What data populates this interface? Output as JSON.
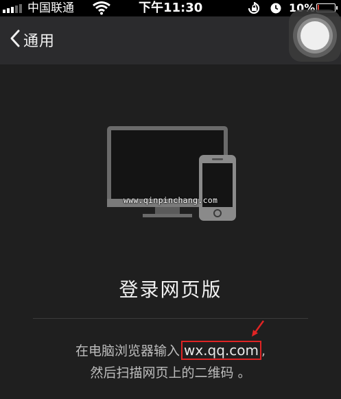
{
  "status_bar": {
    "carrier": "中国联通",
    "time": "下午11:30",
    "battery_text": "10%",
    "battery_level": 0.1,
    "signal_bars_active": 3,
    "signal_bars_total": 5
  },
  "nav": {
    "back_label": "通用"
  },
  "illustration": {
    "watermark": "www.qinpinchang.com"
  },
  "main": {
    "title": "登录网页版",
    "instruction_prefix": "在电脑浏览器输入",
    "url": "wx.qq.com",
    "instruction_suffix": ",",
    "instruction_line2": "然后扫描网页上的二维码 。"
  },
  "colors": {
    "highlight_box": "#e02424",
    "background": "#1f1f1f",
    "nav_background": "#2b2b2d"
  },
  "icons": {
    "back": "chevron-left-icon",
    "wifi": "wifi-icon",
    "rotation_lock": "rotation-lock-icon",
    "alarm": "alarm-icon",
    "battery": "battery-icon",
    "assistive_touch": "assistive-touch-icon",
    "devices": "computer-phone-icon",
    "arrow": "red-arrow-icon"
  }
}
